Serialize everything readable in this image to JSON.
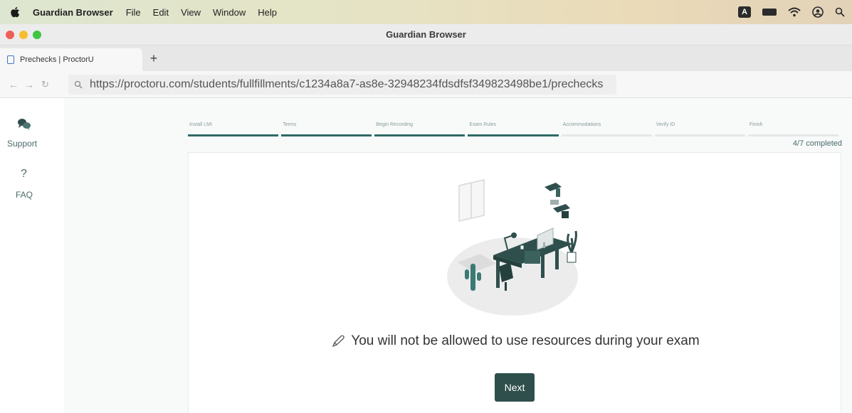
{
  "menubar": {
    "app_name": "Guardian Browser",
    "items": [
      "File",
      "Edit",
      "View",
      "Window",
      "Help"
    ],
    "input_source": "A"
  },
  "window": {
    "title": "Guardian Browser"
  },
  "tabs": [
    {
      "label": "Prechecks | ProctorU"
    }
  ],
  "newtab_label": "+",
  "address": {
    "url": "https://proctoru.com/students/fullfillments/c1234a8a7-as8e-32948234fdsdfsf349823498be1/prechecks"
  },
  "sidebar": {
    "items": [
      {
        "label": "Support",
        "icon": "chat-bubbles-icon"
      },
      {
        "label": "FAQ",
        "icon": "question-mark-icon",
        "glyph": "?"
      }
    ]
  },
  "progress": {
    "steps": [
      {
        "label": "Install LMI",
        "done": true
      },
      {
        "label": "Terms",
        "done": true
      },
      {
        "label": "Begin Recording",
        "done": true
      },
      {
        "label": "Exam Rules",
        "done": true
      },
      {
        "label": "Accommodations",
        "done": false
      },
      {
        "label": "Verify ID",
        "done": false
      },
      {
        "label": "Finish",
        "done": false
      }
    ],
    "completed_text": "4/7 completed",
    "completed_fraction": 0.571
  },
  "main": {
    "message": "You will not be allowed to use resources during your exam",
    "next_label": "Next"
  },
  "colors": {
    "accent": "#2f4f4c",
    "step_done": "#2e6a66"
  }
}
